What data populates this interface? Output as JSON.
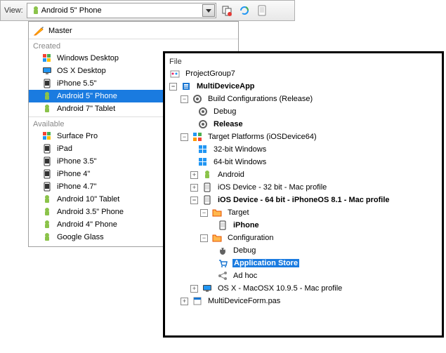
{
  "toolbar": {
    "view_label": "View:",
    "selected_view": "Android 5\" Phone"
  },
  "dropdown": {
    "master": "Master",
    "section_created": "Created",
    "created_items": [
      {
        "label": "Windows Desktop",
        "icon": "windows"
      },
      {
        "label": "OS X Desktop",
        "icon": "mac"
      },
      {
        "label": "iPhone 5.5\"",
        "icon": "phone"
      },
      {
        "label": "Android 5\" Phone",
        "icon": "android",
        "selected": true
      },
      {
        "label": "Android 7\" Tablet",
        "icon": "android"
      }
    ],
    "section_available": "Available",
    "available_items": [
      {
        "label": "Surface Pro",
        "icon": "windows"
      },
      {
        "label": "iPad",
        "icon": "phone"
      },
      {
        "label": "iPhone 3.5\"",
        "icon": "phone"
      },
      {
        "label": "iPhone 4\"",
        "icon": "phone"
      },
      {
        "label": "iPhone 4.7\"",
        "icon": "phone"
      },
      {
        "label": "Android 10\" Tablet",
        "icon": "android"
      },
      {
        "label": "Android 3.5\" Phone",
        "icon": "android"
      },
      {
        "label": "Android 4\" Phone",
        "icon": "android"
      },
      {
        "label": "Google Glass",
        "icon": "android"
      }
    ]
  },
  "project": {
    "file_label": "File",
    "group": "ProjectGroup7",
    "app": "MultiDeviceApp",
    "build_config": "Build Configurations (Release)",
    "debug": "Debug",
    "release": "Release",
    "target_platforms": "Target Platforms (iOSDevice64)",
    "win32": "32-bit Windows",
    "win64": "64-bit Windows",
    "android": "Android",
    "ios32": "iOS Device - 32 bit - Mac profile",
    "ios64": "iOS Device - 64 bit - iPhoneOS 8.1 - Mac profile",
    "target": "Target",
    "iphone": "iPhone",
    "configuration": "Configuration",
    "cfg_debug": "Debug",
    "app_store": "Application Store",
    "adhoc": "Ad hoc",
    "osx": "OS X - MacOSX 10.9.5 - Mac profile",
    "form_file": "MultiDeviceForm.pas"
  }
}
